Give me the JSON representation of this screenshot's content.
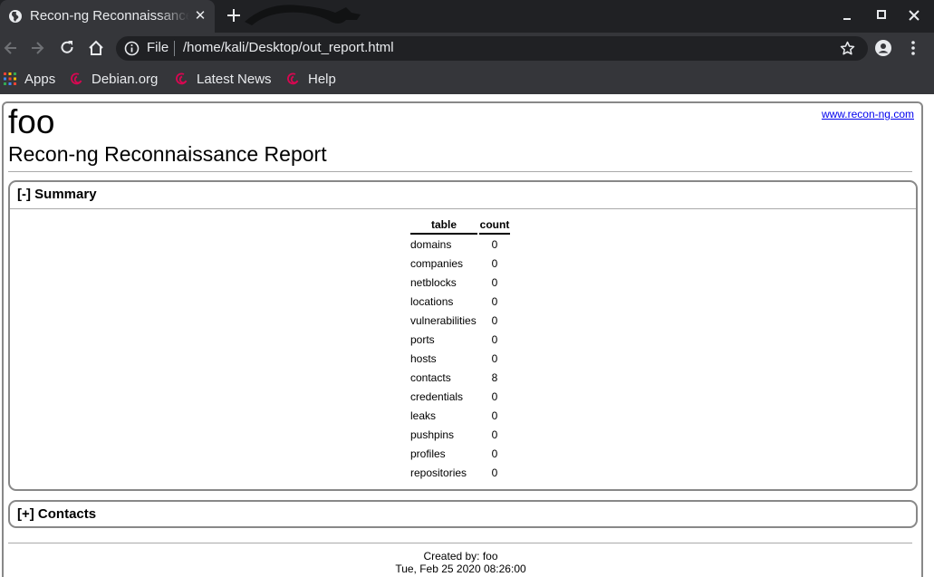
{
  "browser": {
    "tab_title": "Recon-ng Reconnaissance Report",
    "address_scheme": "File",
    "address_url": "/home/kali/Desktop/out_report.html",
    "bookmarks": [
      "Apps",
      "Debian.org",
      "Latest News",
      "Help"
    ],
    "colors": {
      "chrome_dark": "#202124",
      "chrome": "#35363a",
      "text": "#e8eaed",
      "debian_red": "#d70751"
    }
  },
  "page": {
    "workspace": "foo",
    "title": "Recon-ng Reconnaissance Report",
    "link": "www.recon-ng.com",
    "summary": {
      "toggle": "[-]",
      "heading": "Summary",
      "headers": {
        "table": "table",
        "count": "count"
      },
      "rows": [
        {
          "table": "domains",
          "count": "0"
        },
        {
          "table": "companies",
          "count": "0"
        },
        {
          "table": "netblocks",
          "count": "0"
        },
        {
          "table": "locations",
          "count": "0"
        },
        {
          "table": "vulnerabilities",
          "count": "0"
        },
        {
          "table": "ports",
          "count": "0"
        },
        {
          "table": "hosts",
          "count": "0"
        },
        {
          "table": "contacts",
          "count": "8"
        },
        {
          "table": "credentials",
          "count": "0"
        },
        {
          "table": "leaks",
          "count": "0"
        },
        {
          "table": "pushpins",
          "count": "0"
        },
        {
          "table": "profiles",
          "count": "0"
        },
        {
          "table": "repositories",
          "count": "0"
        }
      ]
    },
    "contacts": {
      "toggle": "[+]",
      "heading": "Contacts"
    },
    "footer": {
      "created_by": "Created by: foo",
      "timestamp": "Tue, Feb 25 2020 08:26:00"
    }
  }
}
